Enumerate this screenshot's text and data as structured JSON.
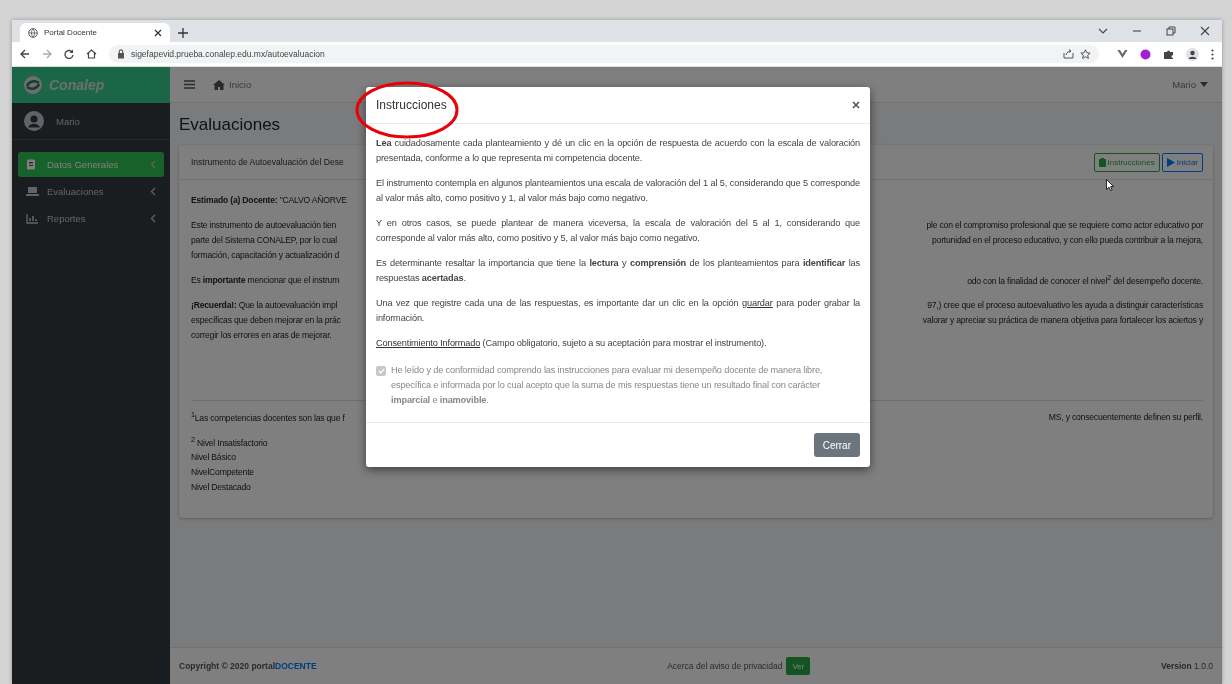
{
  "browser": {
    "tab_title": "Portal Docente",
    "url": "sigefapevid.prueba.conalep.edu.mx/autoevaluacion"
  },
  "sidebar": {
    "brand": "Conalep",
    "user": "Mario",
    "items": [
      {
        "label": "Datos Generales",
        "selected": true
      },
      {
        "label": "Evaluaciones",
        "selected": false
      },
      {
        "label": "Reportes",
        "selected": false
      }
    ]
  },
  "navbar": {
    "breadcrumb": "Inicio",
    "user_menu": "Mario"
  },
  "page_title": "Evaluaciones",
  "card": {
    "title": "Instrumento de Autoevaluación del Dese",
    "buttons": [
      {
        "label": "Instrucciones",
        "kind": "instructions"
      },
      {
        "label": "Iniciar",
        "kind": "start"
      }
    ],
    "paragraphs": [
      [
        {
          "left": "**Estimado (a) Docente:** \"CALVO AÑORVE"
        }
      ],
      [
        {
          "left": "Este instrumento de autoevaluación tien",
          "right": "ple con el compromiso profesional que se requiere como actor educativo por"
        },
        {
          "left": "parte del Sistema CONALEP, por lo cual",
          "right": "portunidad en el proceso educativo, y con ello pueda contribuir a la mejora,"
        },
        {
          "left": "formación, capacitación y actualización d"
        }
      ],
      [
        {
          "left": "Es **importante** mencionar que el instrum",
          "right": "odo con la finalidad de conocer el nivel$^{2}$ del desempeño docente."
        }
      ],
      [
        {
          "left": "**¡Recuerda!:** Que la autoevaluación impl",
          "right": "97,) cree que el proceso autoevaluativo les ayuda a distinguir características"
        },
        {
          "left": "específicas que deben mejorar en la prác",
          "right": "valorar y apreciar su práctica de manera objetiva para fortalecer los aciertos y"
        },
        {
          "left": "corregir los errores en aras de mejorar."
        }
      ]
    ],
    "footnotes": [
      [
        {
          "left": "$^{1}$Las competencias docentes son las que f",
          "right": "MS, y consecuentemente definen su perfil."
        }
      ],
      [
        {
          "left": "$^{2}$ Nivel Insatisfactorio"
        },
        {
          "left": "Nivel Básico"
        },
        {
          "left": "NivelCompetente"
        },
        {
          "left": "Nivel Destacado"
        }
      ]
    ]
  },
  "modal": {
    "title": "Instrucciones",
    "paragraphs": [
      [
        {
          "kind": "text",
          "text": "**Lea** cuidadosamente cada planteamiento y dé un clic en la opción de respuesta de acuerdo con la escala de valoración presentada, conforme a lo que representa mi competencia docente."
        }
      ],
      [
        {
          "kind": "text",
          "text": "El instrumento contempla en algunos planteamientos una escala de valoración del 1 al 5, considerando que 5 corresponde al valor más alto, como positivo y 1, al valor más bajo como negativo."
        }
      ],
      [
        {
          "kind": "text",
          "text": "Y en otros casos, se puede plantear de manera viceversa, la escala de valoración del 5 al 1, considerando que corresponde al valor más alto, como positivo y 5, al valor más bajo como negativo."
        }
      ],
      [
        {
          "kind": "text",
          "text": "Es determinante resaltar la importancia que tiene la **lectura** y **comprensión** de los planteamientos para **identificar** las respuestas **acertadas**."
        }
      ],
      [
        {
          "kind": "text",
          "text": "Una vez que registre cada una de las respuestas, es importante dar un clic en la opción "
        },
        {
          "kind": "link",
          "text": "guardar"
        },
        {
          "kind": "text",
          "text": " para poder grabar la información."
        }
      ],
      [
        {
          "kind": "link",
          "text": "Consentimiento Informado"
        },
        {
          "kind": "text",
          "text": " (Campo obligatorio, sujeto a su aceptación para mostrar el instrumento)."
        }
      ]
    ],
    "consent": {
      "checked": true,
      "disabled": true,
      "label": "He leído y de conformidad comprendo las instrucciones para evaluar mi desempeño docente de manera libre, específica e informada por lo cual acepto que la suma de mis respuestas tiene un resultado final con carácter **imparcial** e **inamovible**."
    },
    "buttons": [
      "Cerrar"
    ]
  },
  "footer": {
    "copyright": [
      {
        "kind": "text",
        "text": "Copyright © 2020 portal"
      },
      {
        "kind": "link",
        "text": "DOCENTE"
      }
    ],
    "privacy": "Acerca del aviso de privacidad",
    "privacy_button": "Ver",
    "version": "**Version** 1.0.0"
  }
}
